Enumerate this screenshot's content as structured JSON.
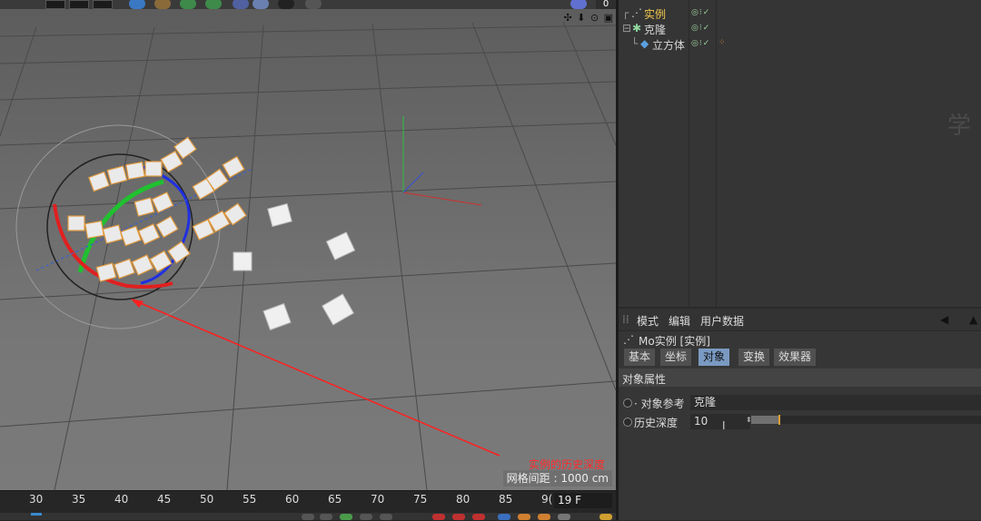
{
  "viewport": {
    "grid_spacing": "网格间距 : 1000 cm",
    "annotation": "实例的历史深度",
    "frame_counter": "0",
    "nav_icons": "✣ ⬇ ⊙ ▣"
  },
  "timeline": {
    "ticks": [
      "30",
      "35",
      "40",
      "45",
      "50",
      "55",
      "60",
      "65",
      "70",
      "75",
      "80",
      "85",
      "9("
    ],
    "current_frame": "19 F"
  },
  "object_manager": {
    "objects": [
      {
        "name": "实例",
        "selected": true
      },
      {
        "name": "克隆",
        "selected": false
      },
      {
        "name": "立方体",
        "selected": false
      }
    ],
    "watermark": "学"
  },
  "attributes": {
    "menu": [
      "模式",
      "编辑",
      "用户数据"
    ],
    "title": "Mo实例 [实例]",
    "tabs": [
      "基本",
      "坐标",
      "对象",
      "变换",
      "效果器"
    ],
    "active_tab": "对象",
    "section": "对象属性",
    "object_ref_label": "对象参考",
    "object_ref_value": "克隆",
    "history_depth_label": "历史深度",
    "history_depth_value": "10",
    "history_depth_fraction": 0.12
  },
  "colors": {
    "accent": "#7a9ac2",
    "selected_text": "#f2c94c",
    "annotation": "#ff2a2a",
    "slider_knob": "#e0a030"
  }
}
